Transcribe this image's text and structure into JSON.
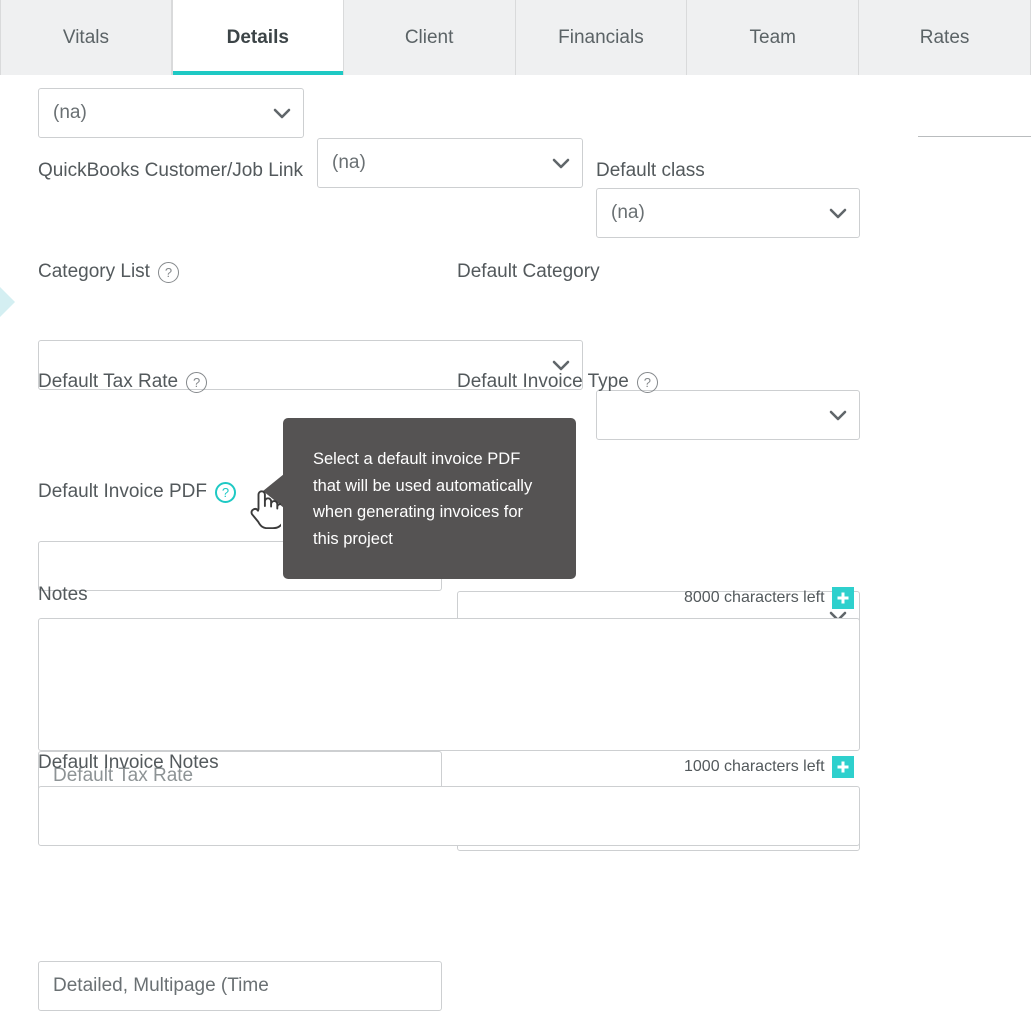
{
  "tabs": [
    {
      "label": "Vitals",
      "active": false
    },
    {
      "label": "Details",
      "active": true
    },
    {
      "label": "Client",
      "active": false
    },
    {
      "label": "Financials",
      "active": false
    },
    {
      "label": "Team",
      "active": false
    },
    {
      "label": "Rates",
      "active": false
    }
  ],
  "colors": {
    "accent_teal": "#1ec9c4",
    "plus_button": "#2ed0cd",
    "left_pointer": "#d4eff2",
    "tooltip_bg": "#555353",
    "tab_bar_bg": "#eff0f1",
    "border": "#cdcfd1",
    "label_text": "#53595c"
  },
  "form": {
    "row_na": {
      "field1": {
        "value": "(na)",
        "icon": "chevron-down-icon"
      },
      "field2": {
        "value": "(na)",
        "icon": "chevron-down-icon"
      },
      "field3": {
        "value": "(na)",
        "icon": "chevron-down-icon"
      }
    },
    "quickbooks_link": {
      "label": "QuickBooks Customer/Job Link",
      "value": "",
      "icon": "chevron-down-icon"
    },
    "default_class": {
      "label": "Default class",
      "value": "",
      "icon": "chevron-down-icon"
    },
    "category_list": {
      "label": "Category List",
      "help_icon": "help-circle-icon",
      "value": "",
      "icon": "chevron-down-icon"
    },
    "default_category": {
      "label": "Default Category",
      "value": "",
      "icon": "chevron-down-icon"
    },
    "default_tax_rate": {
      "label": "Default Tax Rate",
      "help_icon": "help-circle-icon",
      "value": "",
      "placeholder": "Default Tax Rate"
    },
    "default_invoice_type": {
      "label": "Default Invoice Type",
      "help_icon": "help-circle-icon",
      "value": "",
      "icon": "chevron-down-icon"
    },
    "default_invoice_pdf": {
      "label": "Default Invoice PDF",
      "help_icon": "help-circle-icon",
      "value": "Detailed, Multipage (Time"
    },
    "notes": {
      "label": "Notes",
      "value": "",
      "counter": "8000 characters left",
      "add_icon": "plus-icon"
    },
    "default_invoice_notes": {
      "label": "Default Invoice Notes",
      "value": "",
      "counter": "1000 characters left",
      "add_icon": "plus-icon"
    }
  },
  "tooltip": {
    "text": "Select a default invoice PDF that will be used automatically when generating invoices for this project",
    "pointer": "left"
  },
  "cursor": {
    "type": "pointing-hand-cursor"
  }
}
